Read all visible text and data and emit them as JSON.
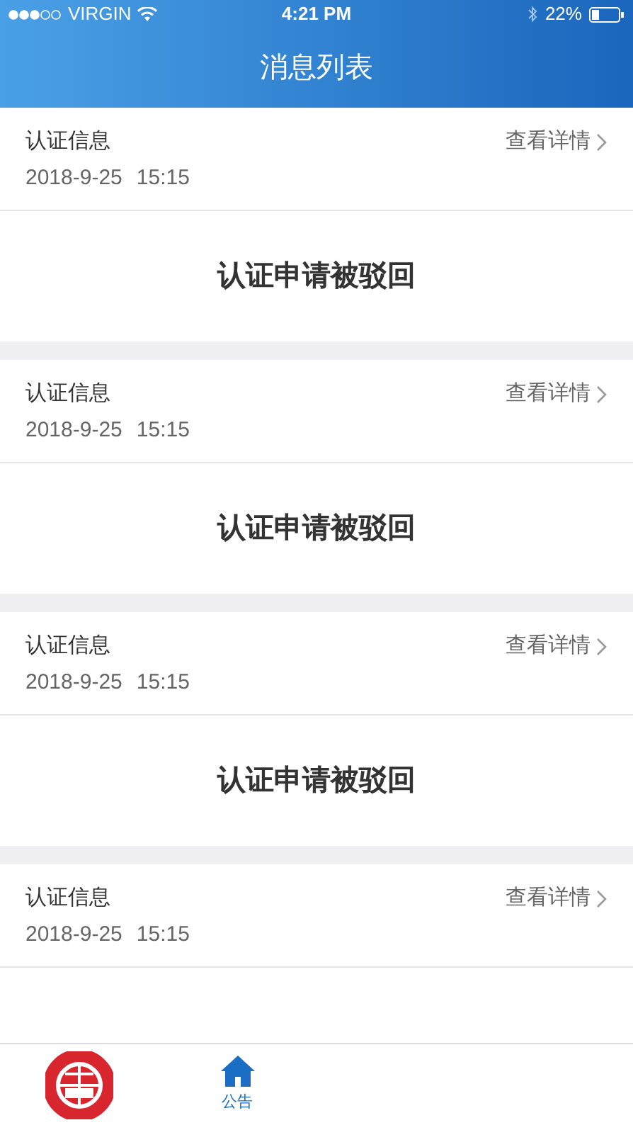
{
  "status_bar": {
    "carrier": "VIRGIN",
    "time": "4:21 PM",
    "battery": "22%"
  },
  "nav": {
    "title": "消息列表"
  },
  "messages": [
    {
      "category": "认证信息",
      "date": "2018-9-25",
      "time": "15:15",
      "link": "查看详情",
      "title": "认证申请被驳回"
    },
    {
      "category": "认证信息",
      "date": "2018-9-25",
      "time": "15:15",
      "link": "查看详情",
      "title": "认证申请被驳回"
    },
    {
      "category": "认证信息",
      "date": "2018-9-25",
      "time": "15:15",
      "link": "查看详情",
      "title": "认证申请被驳回"
    },
    {
      "category": "认证信息",
      "date": "2018-9-25",
      "time": "15:15",
      "link": "查看详情"
    }
  ],
  "tab_bar": [
    {
      "kind": "logo",
      "selected": false
    },
    {
      "kind": "home",
      "label": "公告",
      "selected": true
    }
  ]
}
